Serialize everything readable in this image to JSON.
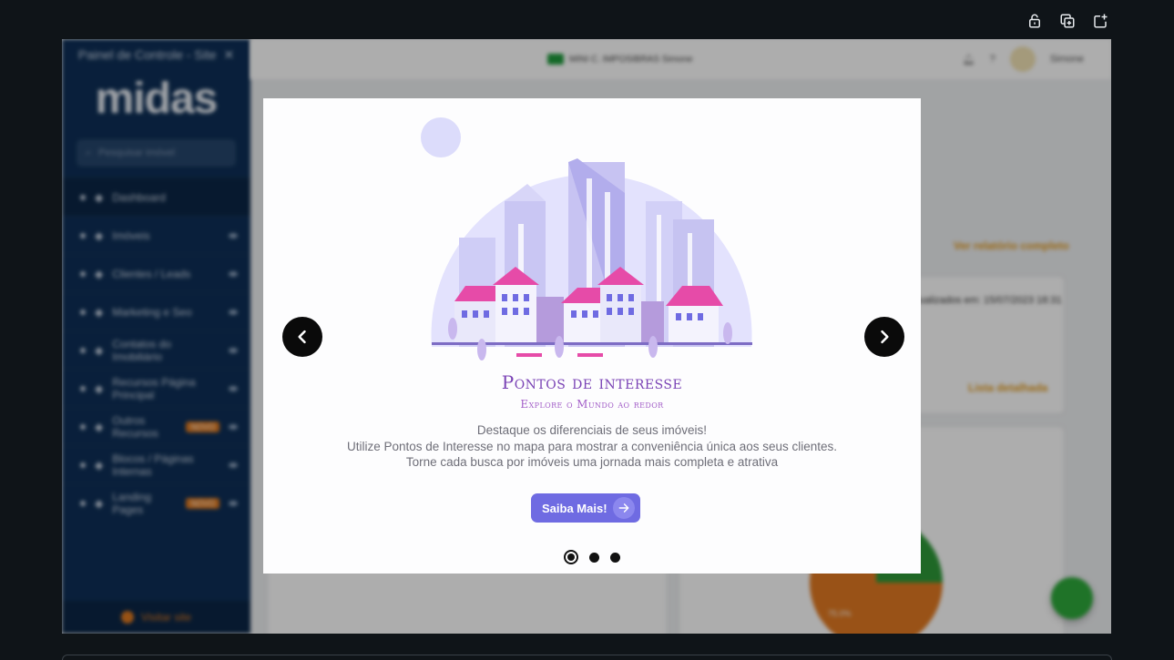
{
  "window": {
    "top_icons": [
      "lock-icon",
      "copy-icon",
      "new-tab-icon"
    ]
  },
  "sidebar": {
    "title": "Painel de Controle - Site",
    "logo": "midas",
    "search_placeholder": "Pesquisar imóvel",
    "items": [
      {
        "label": "Dashboard",
        "icon": "dashboard-icon",
        "badge": ""
      },
      {
        "label": "Imóveis",
        "icon": "home-icon",
        "badge": ""
      },
      {
        "label": "Clientes / Leads",
        "icon": "users-icon",
        "badge": ""
      },
      {
        "label": "Marketing e Seo",
        "icon": "chart-icon",
        "badge": ""
      },
      {
        "label": "Contatos do Imobiliário",
        "icon": "phone-icon",
        "badge": ""
      },
      {
        "label": "Recursos Página Principal",
        "icon": "layout-icon",
        "badge": ""
      },
      {
        "label": "Outros Recursos",
        "icon": "grid-icon",
        "badge": "NOVO"
      },
      {
        "label": "Blocos / Páginas Internas",
        "icon": "pages-icon",
        "badge": ""
      },
      {
        "label": "Landing Pages",
        "icon": "landing-icon",
        "badge": "NOVO"
      }
    ],
    "footer": "Visitar site"
  },
  "topbar": {
    "center_text": "MINI C. IMPOSIBRAS Simone",
    "user": "Simone",
    "help": "?"
  },
  "dashboard": {
    "report_link": "Ver relatório completo",
    "updated_text": "Dados atualizados em: 15/07/2023 18:31",
    "detail_link": "Lista detalhada",
    "pie_label": "75.0%"
  },
  "modal": {
    "title": "Pontos de interesse",
    "subtitle": "Explore o Mundo ao redor",
    "lines": [
      "Destaque os diferenciais de seus imóveis!",
      "Utilize Pontos de Interesse no mapa para mostrar a conveniência única aos seus clientes.",
      "Torne cada busca por imóveis uma jornada mais completa e atrativa"
    ],
    "button_label": "Saiba Mais!",
    "slides_total": 3,
    "active_slide": 1
  },
  "colors": {
    "accent": "#6f6be2",
    "title": "#7a43b5",
    "sidebar": "#0e2f57",
    "orange": "#e39a1c"
  }
}
